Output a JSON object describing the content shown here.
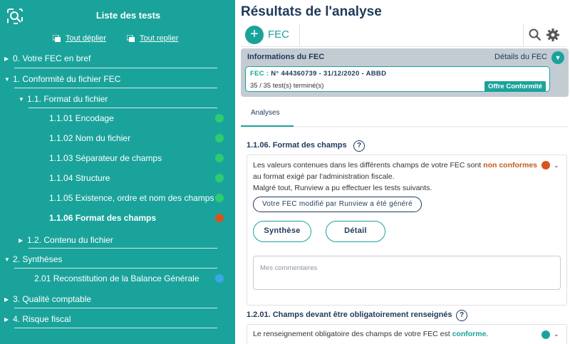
{
  "sidebar": {
    "title": "Liste des tests",
    "expand_all": "Tout déplier",
    "collapse_all": "Tout replier",
    "items": [
      {
        "label": "0. Votre FEC en bref",
        "arrow": "▶"
      },
      {
        "label": "1. Conformité du fichier FEC",
        "arrow": "▼"
      },
      {
        "label": "1.1. Format du fichier",
        "arrow": "▼"
      },
      {
        "label": "1.1.01 Encodage",
        "status": "#2ecc71"
      },
      {
        "label": "1.1.02 Nom du fichier",
        "status": "#2ecc71"
      },
      {
        "label": "1.1.03 Séparateur de champs",
        "status": "#2ecc71"
      },
      {
        "label": "1.1.04 Structure",
        "status": "#2ecc71"
      },
      {
        "label": "1.1.05 Existence, ordre et nom des champs",
        "status": "#2ecc71"
      },
      {
        "label": "1.1.06 Format des champs",
        "status": "#e05a1c"
      },
      {
        "label": "1.2. Contenu du fichier",
        "arrow": "▶"
      },
      {
        "label": "2. Synthèses",
        "arrow": "▼"
      },
      {
        "label": "2.01 Reconstitution de la Balance Générale",
        "status": "#3aa7e8"
      },
      {
        "label": "3. Qualité comptable",
        "arrow": "▶"
      },
      {
        "label": "4. Risque fiscal",
        "arrow": "▶"
      }
    ]
  },
  "main": {
    "title": "Résultats de l'analyse",
    "add_label": "+",
    "fec_label": "FEC",
    "info": {
      "title": "Informations du FEC",
      "details": "Détails du FEC",
      "fec_key": "FEC :",
      "fec_value": "N° 444360739 - 31/12/2020 - ABBD",
      "tests": "35 / 35 test(s) terminé(s)",
      "offer": "Offre Conformité"
    },
    "tab_analyses": "Analyses",
    "section1": {
      "title": "1.1.06. Format des champs",
      "help": "?",
      "line1_a": "Les valeurs contenues dans les différents champs de votre FEC sont ",
      "line1_b": "non conformes",
      "line2": "au format exigé par l'administration fiscale.",
      "line3": "Malgré tout, Runview a pu effectuer les tests suivants.",
      "modified": "Votre FEC modifié par Runview a été généré",
      "synthese": "Synthèse",
      "detail": "Détail",
      "comments_placeholder": "Mes commentaires",
      "status_color": "#d9531e"
    },
    "section2": {
      "title": "1.2.01. Champs devant être obligatoirement renseignés",
      "help": "?",
      "line_a": "Le renseignement obligatoire des champs de votre FEC est ",
      "line_b": "conforme",
      "line_c": ".",
      "status_color": "#1aa39b"
    }
  },
  "colors": {
    "accent": "#1aa39b",
    "navy": "#1e3a5a",
    "warning": "#d9531e"
  },
  "icons": [
    "runview-logo-icon",
    "expand-all-icon",
    "collapse-all-icon",
    "plus-icon",
    "search-icon",
    "gear-icon",
    "chevron-down-icon",
    "help-icon"
  ]
}
